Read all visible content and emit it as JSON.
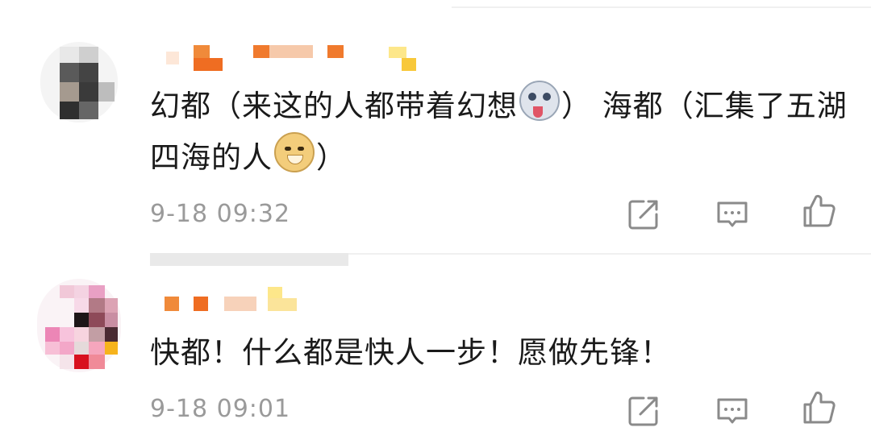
{
  "comments": [
    {
      "username": "",
      "text_before_emoji1": "幻都（来这的人都带着幻想",
      "text_after_emoji1": "） 海都（汇集了五湖四海的人",
      "text_after_emoji2": "）",
      "emoji1_icon": "husky-emoji-icon",
      "emoji2_icon": "doge-emoji-icon",
      "timestamp": "9-18 09:32"
    },
    {
      "username": "",
      "text": "快都！什么都是快人一步！愿做先锋！",
      "timestamp": "9-18 09:01"
    }
  ],
  "actions": {
    "share_icon": "share-icon",
    "reply_icon": "comment-icon",
    "like_icon": "thumbs-up-icon"
  },
  "colors": {
    "text": "#1a1a1a",
    "meta": "#9a9a9a",
    "icon": "#8a8a8a",
    "mosaic_orange": "#ef7d2a",
    "mosaic_yellow": "#f8d24a"
  }
}
